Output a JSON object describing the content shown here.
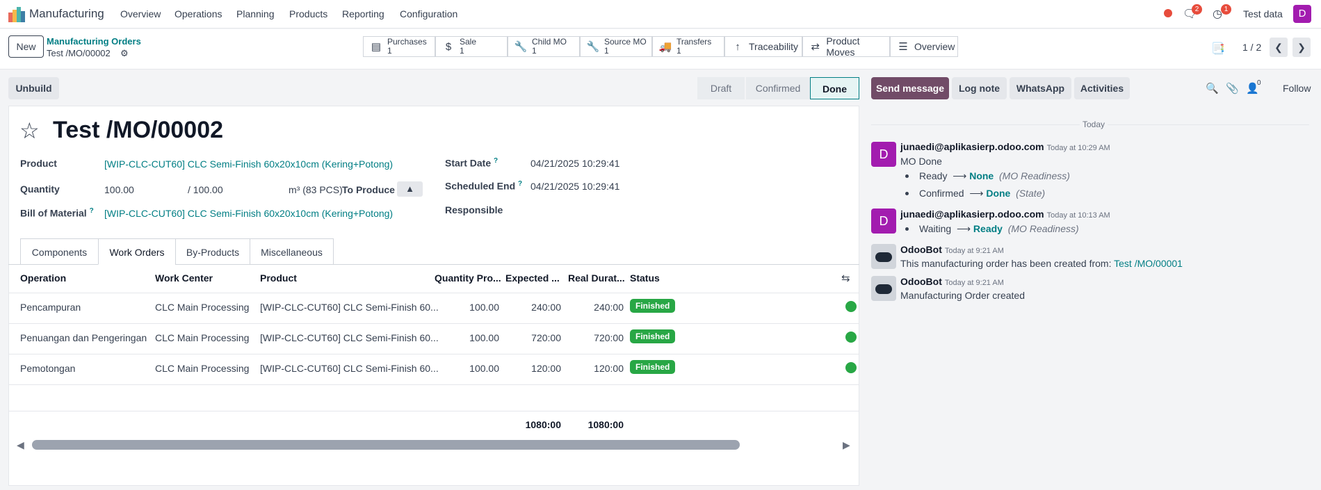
{
  "app": {
    "name": "Manufacturing"
  },
  "menu": [
    "Overview",
    "Operations",
    "Planning",
    "Products",
    "Reporting",
    "Configuration"
  ],
  "systray": {
    "messages_count": "2",
    "activities_count": "1",
    "company": "Test data",
    "avatar": "D"
  },
  "control": {
    "new_label": "New",
    "breadcrumb_parent": "Manufacturing Orders",
    "breadcrumb_current": "Test /MO/00002",
    "pager": "1 / 2"
  },
  "smart_buttons": [
    {
      "label": "Purchases",
      "count": "1",
      "icon": "credit-card-icon"
    },
    {
      "label": "Sale",
      "count": "1",
      "icon": "dollar-icon"
    },
    {
      "label": "Child MO",
      "count": "1",
      "icon": "wrench-icon"
    },
    {
      "label": "Source MO",
      "count": "1",
      "icon": "wrench-icon"
    },
    {
      "label": "Transfers",
      "count": "1",
      "icon": "truck-icon"
    },
    {
      "label": "Traceability",
      "icon": "arrow-up-icon"
    },
    {
      "label": "Product Moves",
      "icon": "exchange-icon"
    },
    {
      "label": "Overview",
      "icon": "list-icon"
    }
  ],
  "actions": {
    "unbuild": "Unbuild"
  },
  "statusbar": [
    "Draft",
    "Confirmed",
    "Done"
  ],
  "form": {
    "title": "Test /MO/00002",
    "product_label": "Product",
    "product_value": "[WIP-CLC-CUT60] CLC Semi-Finish 60x20x10cm (Kering+Potong)",
    "quantity_label": "Quantity",
    "quantity_value": "100.00",
    "quantity_of": "/ 100.00",
    "quantity_uom": "m³ (83 PCS)",
    "to_produce": "To Produce",
    "bom_label": "Bill of Material",
    "bom_value": "[WIP-CLC-CUT60] CLC Semi-Finish 60x20x10cm (Kering+Potong)",
    "start_label": "Start Date",
    "start_value": "04/21/2025 10:29:41",
    "end_label": "Scheduled End",
    "end_value": "04/21/2025 10:29:41",
    "responsible_label": "Responsible",
    "help_mark": "?"
  },
  "tabs": [
    "Components",
    "Work Orders",
    "By-Products",
    "Miscellaneous"
  ],
  "table": {
    "headers": [
      "Operation",
      "Work Center",
      "Product",
      "Quantity Pro...",
      "Expected ...",
      "Real Durat...",
      "Status"
    ],
    "rows": [
      {
        "operation": "Pencampuran",
        "center": "CLC Main Processing",
        "product": "[WIP-CLC-CUT60] CLC Semi-Finish 60...",
        "qty": "100.00",
        "expected": "240:00",
        "real": "240:00",
        "status": "Finished"
      },
      {
        "operation": "Penuangan dan Pengeringan",
        "center": "CLC Main Processing",
        "product": "[WIP-CLC-CUT60] CLC Semi-Finish 60...",
        "qty": "100.00",
        "expected": "720:00",
        "real": "720:00",
        "status": "Finished"
      },
      {
        "operation": "Pemotongan",
        "center": "CLC Main Processing",
        "product": "[WIP-CLC-CUT60] CLC Semi-Finish 60...",
        "qty": "100.00",
        "expected": "120:00",
        "real": "120:00",
        "status": "Finished"
      }
    ],
    "total_expected": "1080:00",
    "total_real": "1080:00"
  },
  "chatter": {
    "send_message": "Send message",
    "log_note": "Log note",
    "whatsapp": "WhatsApp",
    "activities": "Activities",
    "followers_count": "0",
    "follow": "Follow",
    "today": "Today",
    "messages": [
      {
        "author": "junaedi@aplikasierp.odoo.com",
        "time": "Today at 10:29 AM",
        "avatar": "D",
        "body": "MO Done",
        "tracking": [
          {
            "old": "Ready",
            "new": "None",
            "field": "(MO Readiness)"
          },
          {
            "old": "Confirmed",
            "new": "Done",
            "field": "(State)"
          }
        ]
      },
      {
        "author": "junaedi@aplikasierp.odoo.com",
        "time": "Today at 10:13 AM",
        "avatar": "D",
        "tracking": [
          {
            "old": "Waiting",
            "new": "Ready",
            "field": "(MO Readiness)"
          }
        ]
      },
      {
        "author": "OdooBot",
        "time": "Today at 9:21 AM",
        "body": "This manufacturing order has been created from:",
        "link": "Test /MO/00001"
      },
      {
        "author": "OdooBot",
        "time": "Today at 9:21 AM",
        "body": "Manufacturing Order created"
      }
    ]
  },
  "colors": {
    "accent": "#017e84",
    "primary": "#714b67",
    "success": "#28a745",
    "avatar": "#a21caf",
    "badge": "#e74c3c"
  }
}
